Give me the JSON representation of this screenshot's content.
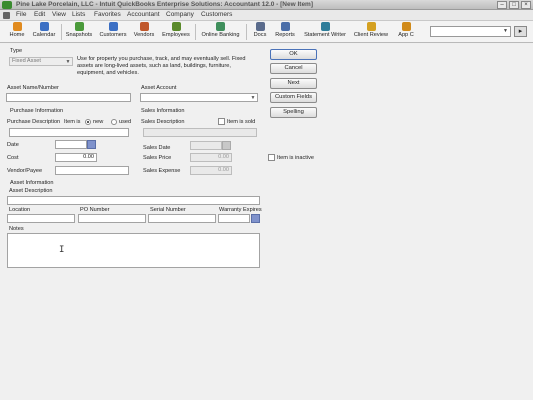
{
  "window": {
    "title": "Pine Lake Porcelain, LLC - Intuit QuickBooks Enterprise Solutions: Accountant 12.0 - [New Item]",
    "controls": [
      "–",
      "□",
      "×"
    ]
  },
  "menubar": {
    "items": [
      "File",
      "Edit",
      "View",
      "Lists",
      "Favorites",
      "Accountant",
      "Company",
      "Customers"
    ]
  },
  "toolbar": {
    "buttons": [
      {
        "label": "Home",
        "icon": "home-icon",
        "color": "#e08a1e"
      },
      {
        "label": "Calendar",
        "icon": "calendar-icon",
        "color": "#3b6fc4"
      },
      {
        "label": "Snapshots",
        "icon": "snapshots-icon",
        "color": "#4a9a3a"
      },
      {
        "label": "Customers",
        "icon": "customers-icon",
        "color": "#3b6fc4"
      },
      {
        "label": "Vendors",
        "icon": "vendors-icon",
        "color": "#c0572b"
      },
      {
        "label": "Employees",
        "icon": "employees-icon",
        "color": "#5a8a2a"
      },
      {
        "label": "Online Banking",
        "icon": "online-banking-icon",
        "color": "#3f8f5c"
      },
      {
        "label": "Docs",
        "icon": "docs-icon",
        "color": "#5a6b8c"
      },
      {
        "label": "Reports",
        "icon": "reports-icon",
        "color": "#4b6ea8"
      },
      {
        "label": "Statement Writer",
        "icon": "statement-writer-icon",
        "color": "#2e7d9a"
      },
      {
        "label": "Client Review",
        "icon": "client-review-icon",
        "color": "#d4a020"
      },
      {
        "label": "App C",
        "icon": "app-center-icon",
        "color": "#d08a1a"
      }
    ],
    "search": {
      "value": ""
    },
    "search_button": "▸"
  },
  "form": {
    "type_label": "Type",
    "type_value": "Fixed Asset",
    "type_description": "Use for property you purchase, track, and may eventually sell. Fixed assets are long-lived assets, such as land, buildings, furniture, equipment, and vehicles.",
    "asset_name_label": "Asset Name/Number",
    "asset_account_label": "Asset Account",
    "purchase_info_label": "Purchase Information",
    "purchase_desc_label": "Purchase Description",
    "item_is_label": "Item is",
    "new_label": "new",
    "used_label": "used",
    "sales_info_label": "Sales Information",
    "sales_desc_label": "Sales Description",
    "item_sold_label": "Item is sold",
    "date_label": "Date",
    "cost_label": "Cost",
    "cost_value": "0.00",
    "vendor_label": "Vendor/Payee",
    "sales_date_label": "Sales Date",
    "sales_price_label": "Sales Price",
    "sales_price_value": "0.00",
    "sales_expense_label": "Sales Expense",
    "sales_expense_value": "0.00",
    "item_inactive_label": "Item is inactive",
    "asset_info_label": "Asset Information",
    "asset_desc_label": "Asset Description",
    "location_label": "Location",
    "po_number_label": "PO Number",
    "serial_number_label": "Serial Number",
    "warranty_label": "Warranty Expires",
    "notes_label": "Notes"
  },
  "side_buttons": {
    "ok": "OK",
    "cancel": "Cancel",
    "next": "Next",
    "custom_fields": "Custom Fields",
    "spelling": "Spelling"
  },
  "colors": {
    "default_button_border": "#4a72b8",
    "calendar_button": "#7f92cc"
  }
}
